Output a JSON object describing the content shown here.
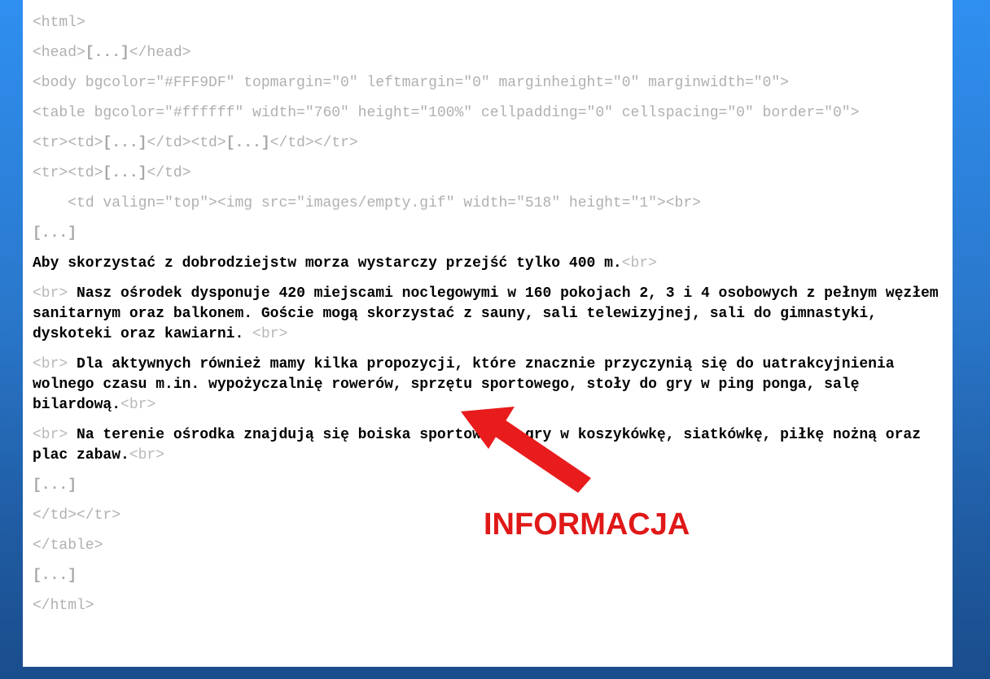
{
  "code_lines": {
    "l1": "<html>",
    "l2_a": "<head>",
    "l2_b": "[...]",
    "l2_c": "</head>",
    "l3": "<body bgcolor=\"#FFF9DF\" topmargin=\"0\" leftmargin=\"0\" marginheight=\"0\" marginwidth=\"0\">",
    "l4": "<table bgcolor=\"#ffffff\" width=\"760\" height=\"100%\" cellpadding=\"0\" cellspacing=\"0\" border=\"0\">",
    "l5_a": "<tr><td>",
    "l5_b": "[...]",
    "l5_c": "</td><td>",
    "l5_d": "[...]",
    "l5_e": "</td></tr>",
    "l6_a": "<tr><td>",
    "l6_b": "[...]",
    "l6_c": "</td>",
    "l7": "    <td valign=\"top\"><img src=\"images/empty.gif\" width=\"518\" height=\"1\"><br>",
    "l8": "[...]",
    "p1_text": "Aby skorzystać z dobrodziejstw morza wystarczy przejść tylko 400 m.",
    "p1_br": "<br>",
    "p2_br1": "<br>",
    "p2_text": " Nasz ośrodek dysponuje 420 miejscami noclegowymi w 160 pokojach 2, 3 i 4 osobowych z pełnym węzłem sanitarnym oraz balkonem. Goście mogą skorzystać z sauny, sali telewizyjnej, sali do gimnastyki, dyskoteki oraz kawiarni. ",
    "p2_br2": "<br>",
    "p3_br1": "<br>",
    "p3_text": " Dla aktywnych również mamy kilka propozycji, które znacznie przyczynią się do uatrakcyjnienia wolnego czasu m.in. wypożyczalnię rowerów, sprzętu sportowego, stoły do gry w ping ponga, salę bilardową.",
    "p3_br2": "<br>",
    "p4_br1": "<br>",
    "p4_text": " Na terenie ośrodka znajdują się boiska sportowe do gry w koszykówkę, siatkówkę, piłkę nożną oraz plac zabaw.",
    "p4_br2": "<br>",
    "l9": "[...]",
    "l10": "</td></tr>",
    "l11": "</table>",
    "l12": "[...]",
    "l13": "</html>"
  },
  "annotation": {
    "label": "INFORMACJA",
    "color": "#e01818"
  },
  "colors": {
    "background_top": "#2f8ff0",
    "background_bottom": "#1a4d8c",
    "code_gray": "#b0b0b0",
    "content_text": "#000000"
  }
}
